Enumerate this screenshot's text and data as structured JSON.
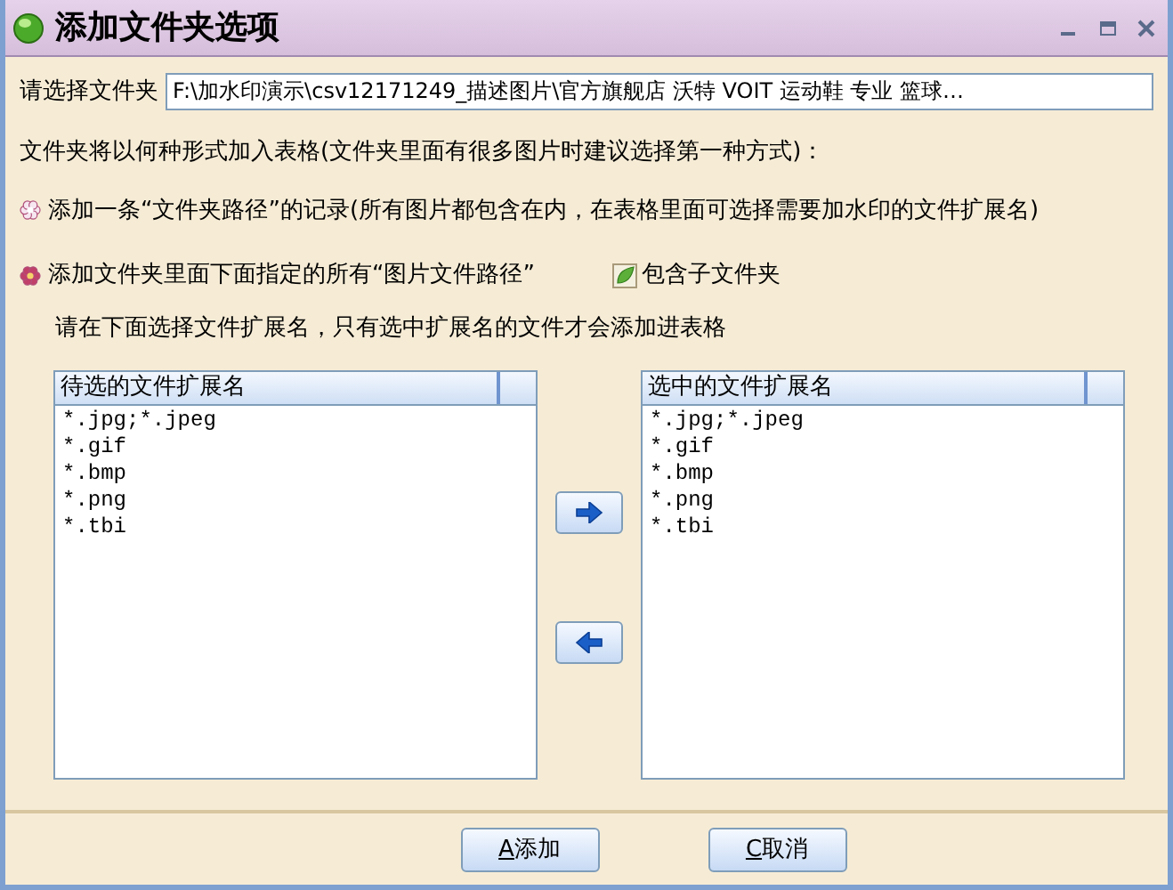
{
  "window": {
    "title": "添加文件夹选项"
  },
  "folder": {
    "label": "请选择文件夹",
    "value": "F:\\加水印演示\\csv12171249_描述图片\\官方旗舰店 沃特 VOIT 运动鞋 专业 篮球…"
  },
  "question": "文件夹将以何种形式加入表格(文件夹里面有很多图片时建议选择第一种方式)：",
  "options": [
    {
      "label": "添加一条“文件夹路径”的记录(所有图片都包含在内，在表格里面可选择需要加水印的文件扩展名)",
      "selected": false
    },
    {
      "label": "添加文件夹里面下面指定的所有“图片文件路径”",
      "selected": true
    }
  ],
  "include_subfolders": {
    "label": "包含子文件夹",
    "checked": true
  },
  "hint": "请在下面选择文件扩展名，只有选中扩展名的文件才会添加进表格",
  "available": {
    "header": "待选的文件扩展名",
    "items": [
      "*.jpg;*.jpeg",
      "*.gif",
      "*.bmp",
      "*.png",
      "*.tbi"
    ]
  },
  "chosen": {
    "header": "选中的文件扩展名",
    "items": [
      "*.jpg;*.jpeg",
      "*.gif",
      "*.bmp",
      "*.png",
      "*.tbi"
    ]
  },
  "buttons": [
    {
      "accel": "A",
      "label": "添加"
    },
    {
      "accel": "C",
      "label": "取消"
    }
  ]
}
